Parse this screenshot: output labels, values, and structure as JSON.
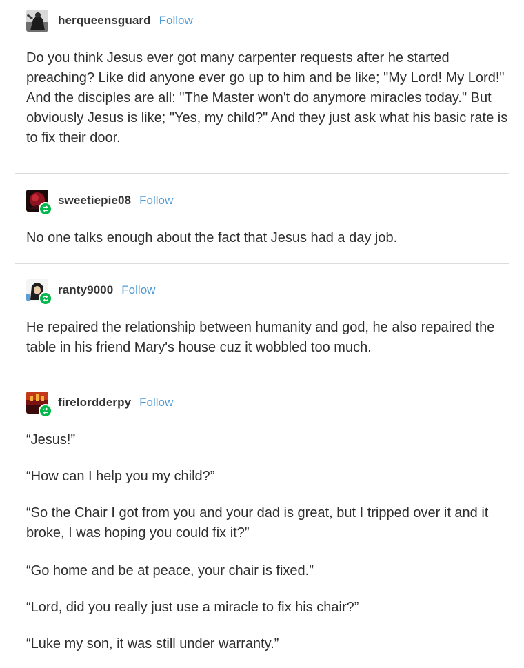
{
  "posts": [
    {
      "username": "herqueensguard",
      "follow_label": "Follow",
      "avatar_icon": "dark-figure-avatar",
      "paragraphs": [
        "Do you think Jesus ever got many carpenter requests after he started preaching? Like did anyone ever go up to him and be like; \"My Lord! My Lord!\" And the disciples are all: \"The Master won't do anymore miracles today.\" But obviously Jesus is like; \"Yes, my child?\" And they just ask what his basic rate is to fix their door."
      ]
    },
    {
      "username": "sweetiepie08",
      "follow_label": "Follow",
      "avatar_icon": "red-black-avatar",
      "paragraphs": [
        "No one talks enough about the fact that Jesus had a day job."
      ]
    },
    {
      "username": "ranty9000",
      "follow_label": "Follow",
      "avatar_icon": "hooded-character-avatar",
      "paragraphs": [
        "He repaired the relationship between humanity and god, he also repaired the table in his friend Mary's house cuz it wobbled too much."
      ]
    },
    {
      "username": "firelordderpy",
      "follow_label": "Follow",
      "avatar_icon": "fire-scene-avatar",
      "paragraphs": [
        "“Jesus!”",
        "“How can I help you my child?”",
        "“So the Chair I got from you and your dad is great, but I tripped over it and it broke, I was hoping you could fix it?”",
        "“Go home and be at peace, your chair is fixed.”",
        "“Lord, did you really just use a miracle to fix his chair?”",
        "“Luke my son, it was still under warranty.”"
      ]
    }
  ],
  "colors": {
    "follow": "#4e9ad6",
    "reblog_badge": "#00b84a",
    "divider": "#dcdcdc",
    "text": "#2e2e2e"
  }
}
